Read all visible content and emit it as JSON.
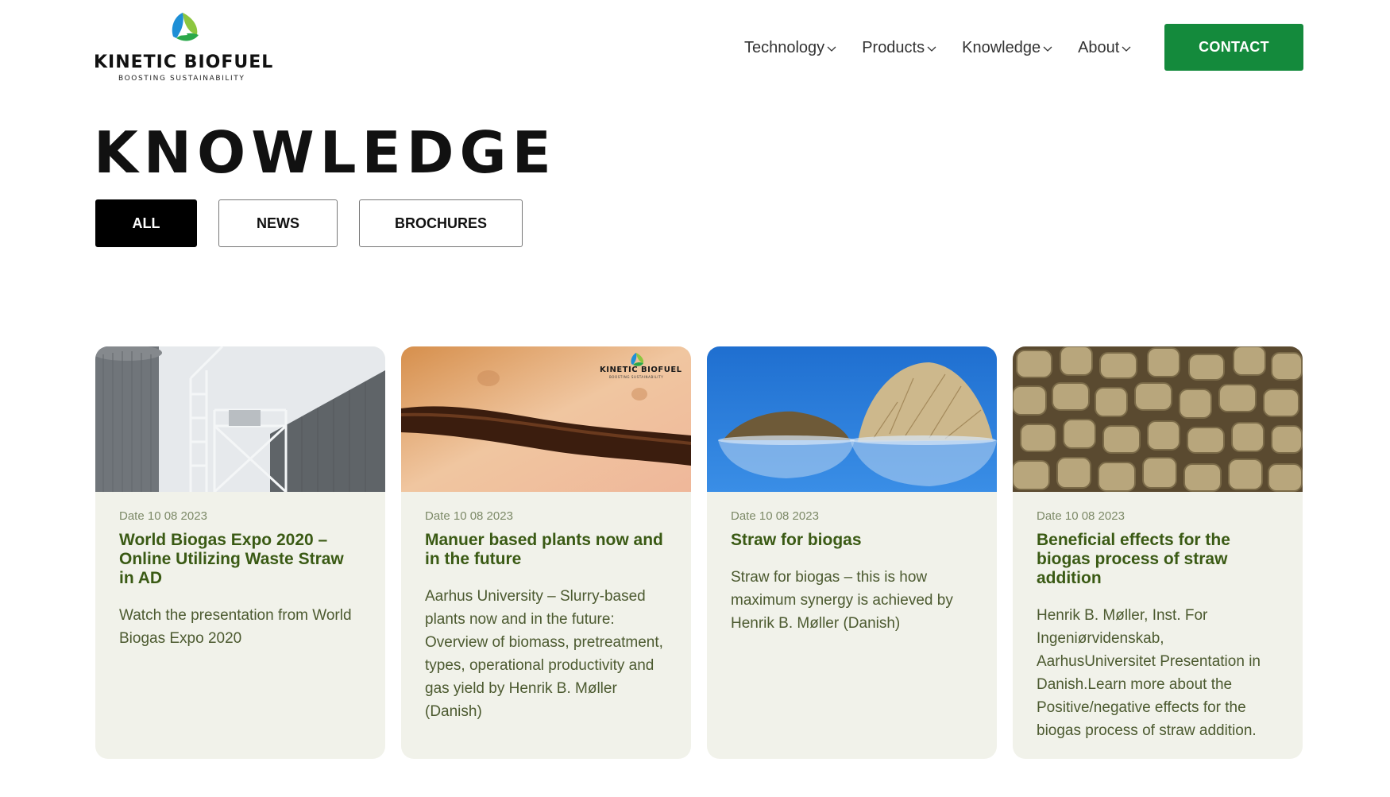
{
  "brand": {
    "name": "KINETIC BIOFUEL",
    "tagline": "BOOSTING SUSTAINABILITY",
    "logo_icon": "tri-leaf-logo",
    "colors": {
      "blue": "#1e8fd6",
      "green": "#2aa84a",
      "lime": "#8cc63f"
    }
  },
  "nav": {
    "items": [
      {
        "label": "Technology"
      },
      {
        "label": "Products"
      },
      {
        "label": "Knowledge"
      },
      {
        "label": "About"
      }
    ],
    "contact_label": "CONTACT",
    "accent": "#148a3c"
  },
  "page": {
    "title": "KNOWLEDGE"
  },
  "filters": [
    {
      "label": "ALL",
      "active": true
    },
    {
      "label": "NEWS",
      "active": false
    },
    {
      "label": "BROCHURES",
      "active": false
    }
  ],
  "cards": [
    {
      "image": "biogas-plant-silo",
      "date": "Date 10 08 2023",
      "title": "World Biogas Expo 2020 – Online Utilizing Waste Straw in AD",
      "text": "Watch the presentation from World Biogas Expo 2020"
    },
    {
      "image": "microscope-fiber",
      "image_watermark": "KINETIC BIOFUEL",
      "image_watermark_tag": "BOOSTING SUSTAINABILITY",
      "date": "Date 10 08 2023",
      "title": "Manuer based plants now and in the future",
      "text": "Aarhus University – Slurry-based plants now and in the future: Overview of biomass, pretreatment, types, operational productivity and gas yield by Henrik B. Møller (Danish)"
    },
    {
      "image": "straw-bowls",
      "date": "Date 10 08 2023",
      "title": "Straw for biogas",
      "text": "Straw for biogas – this is how maximum synergy is achieved by Henrik B. Møller (Danish)"
    },
    {
      "image": "straw-pellets",
      "date": "Date 10 08 2023",
      "title": "Beneficial effects for the biogas process of straw addition",
      "text": "Henrik B. Møller, Inst. For Ingeniørvidenskab, AarhusUniversitet Presentation in Danish.Learn more about the Positive/negative effects for the biogas process of straw addition."
    }
  ]
}
